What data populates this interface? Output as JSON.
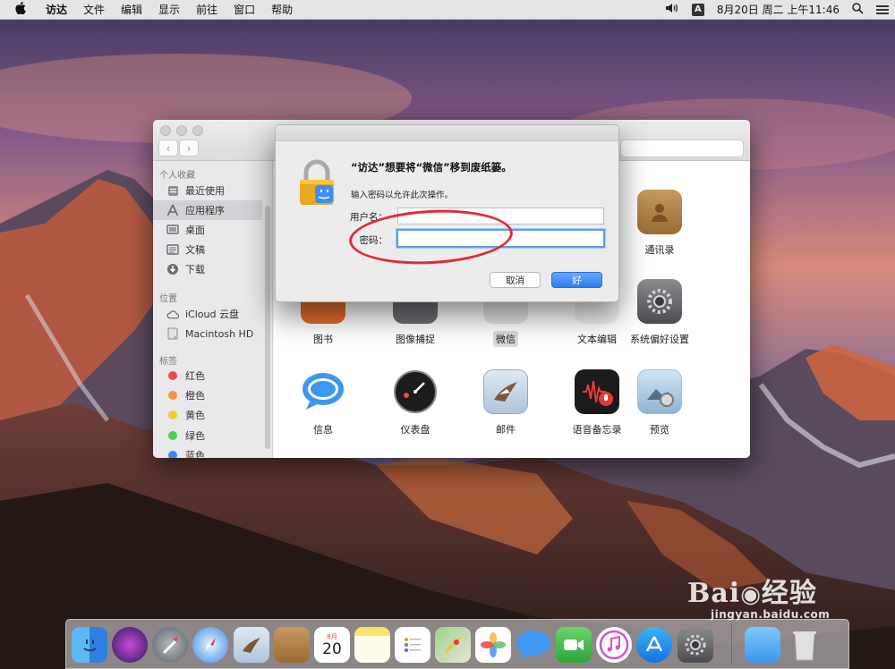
{
  "menubar": {
    "apple_icon": "apple-logo",
    "items": [
      "访达",
      "文件",
      "编辑",
      "显示",
      "前往",
      "窗口",
      "帮助"
    ],
    "input_source": "A",
    "clock": "8月20日 周二 上午11:46"
  },
  "finder": {
    "sidebar": {
      "favorites_heading": "个人收藏",
      "favorites": [
        {
          "label": "最近使用",
          "icon": "recents-icon"
        },
        {
          "label": "应用程序",
          "icon": "applications-icon"
        },
        {
          "label": "桌面",
          "icon": "desktop-icon"
        },
        {
          "label": "文稿",
          "icon": "documents-icon"
        },
        {
          "label": "下载",
          "icon": "downloads-icon"
        }
      ],
      "locations_heading": "位置",
      "locations": [
        {
          "label": "iCloud 云盘",
          "icon": "icloud-icon"
        },
        {
          "label": "Macintosh HD",
          "icon": "hard-disk-icon"
        }
      ],
      "tags_heading": "标签",
      "tags": [
        {
          "label": "红色",
          "color": "#ef4b4b"
        },
        {
          "label": "橙色",
          "color": "#f6953a"
        },
        {
          "label": "黄色",
          "color": "#f5cb31"
        },
        {
          "label": "绿色",
          "color": "#4ccf4a"
        },
        {
          "label": "蓝色",
          "color": "#3f86f5"
        }
      ]
    },
    "apps": [
      {
        "label": "通讯录",
        "icon": "contacts-icon"
      },
      {
        "label": "图书",
        "icon": "books-icon"
      },
      {
        "label": "图像捕捉",
        "icon": "image-capture-icon"
      },
      {
        "label": "微信",
        "icon": "wechat-icon"
      },
      {
        "label": "文本编辑",
        "icon": "textedit-icon"
      },
      {
        "label": "系统偏好设置",
        "icon": "system-preferences-icon"
      },
      {
        "label": "信息",
        "icon": "messages-icon"
      },
      {
        "label": "仪表盘",
        "icon": "dashboard-icon"
      },
      {
        "label": "邮件",
        "icon": "mail-icon"
      },
      {
        "label": "语音备忘录",
        "icon": "voice-memos-icon"
      },
      {
        "label": "预览",
        "icon": "preview-icon"
      }
    ]
  },
  "dialog": {
    "title": "“访达”想要将“微信”移到废纸篓。",
    "message": "输入密码以允许此次操作。",
    "username_label": "用户名：",
    "username_value": "",
    "password_label": "密码：",
    "password_value": "",
    "cancel_label": "取消",
    "ok_label": "好"
  },
  "dock": {
    "apps": [
      "finder-icon",
      "siri-icon",
      "launchpad-icon",
      "safari-icon",
      "mail-icon",
      "contacts-icon",
      "calendar-icon",
      "notes-icon",
      "reminders-icon",
      "maps-icon",
      "photos-icon",
      "messages-icon",
      "facetime-icon",
      "itunes-icon",
      "app-store-icon",
      "system-preferences-icon",
      "downloads-stack-icon",
      "trash-icon"
    ],
    "calendar_month": "8月",
    "calendar_day": "20"
  },
  "watermark": {
    "brand": "Bai",
    "brand_cn": "经验",
    "url": "jingyan.baidu.com"
  }
}
